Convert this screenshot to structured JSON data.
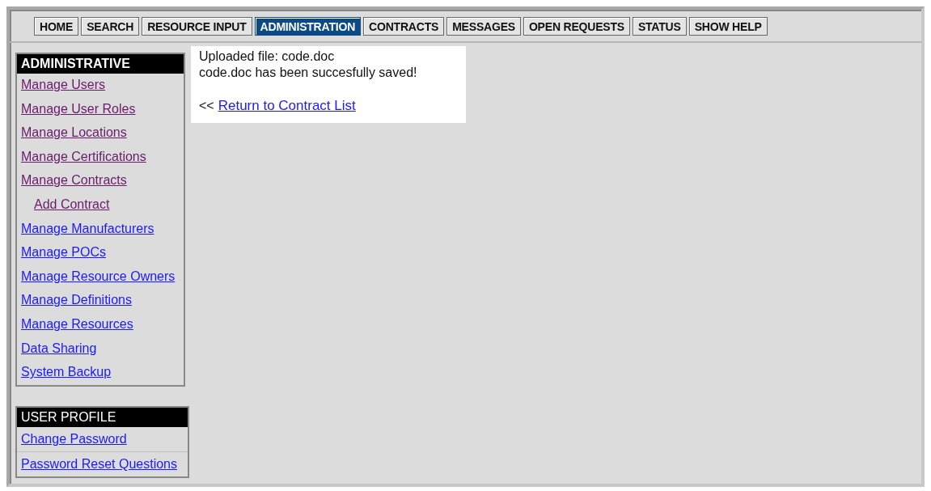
{
  "nav": [
    {
      "label": "HOME",
      "selected": false
    },
    {
      "label": "SEARCH",
      "selected": false
    },
    {
      "label": "RESOURCE INPUT",
      "selected": false
    },
    {
      "label": "ADMINISTRATION",
      "selected": true
    },
    {
      "label": "CONTRACTS",
      "selected": false
    },
    {
      "label": "MESSAGES",
      "selected": false
    },
    {
      "label": "OPEN REQUESTS",
      "selected": false
    },
    {
      "label": "STATUS",
      "selected": false
    },
    {
      "label": "SHOW HELP",
      "selected": false
    }
  ],
  "admin_menu": {
    "title": "ADMINISTRATIVE",
    "items": [
      {
        "label": "Manage Users",
        "visited": true
      },
      {
        "label": "Manage User Roles",
        "visited": true
      },
      {
        "label": "Manage Locations",
        "visited": true
      },
      {
        "label": "Manage Certifications",
        "visited": true
      },
      {
        "label": "Manage Contracts",
        "visited": true,
        "children": [
          {
            "label": "Add Contract",
            "visited": true
          }
        ]
      },
      {
        "label": "Manage Manufacturers",
        "visited": false
      },
      {
        "label": "Manage POCs",
        "visited": false
      },
      {
        "label": "Manage Resource Owners",
        "visited": false
      },
      {
        "label": "Manage Definitions",
        "visited": false
      },
      {
        "label": "Manage Resources",
        "visited": false
      },
      {
        "label": "Data Sharing",
        "visited": false
      },
      {
        "label": "System Backup",
        "visited": false
      }
    ]
  },
  "profile_menu": {
    "title": "USER PROFILE",
    "items": [
      {
        "label": "Change Password",
        "visited": false
      },
      {
        "label": "Password Reset Questions",
        "visited": false
      }
    ]
  },
  "message": {
    "lines": [
      "Uploaded file: code.doc",
      "code.doc has been succesfully saved!"
    ],
    "back_prefix": "<<",
    "back_link": "Return to Contract List"
  }
}
